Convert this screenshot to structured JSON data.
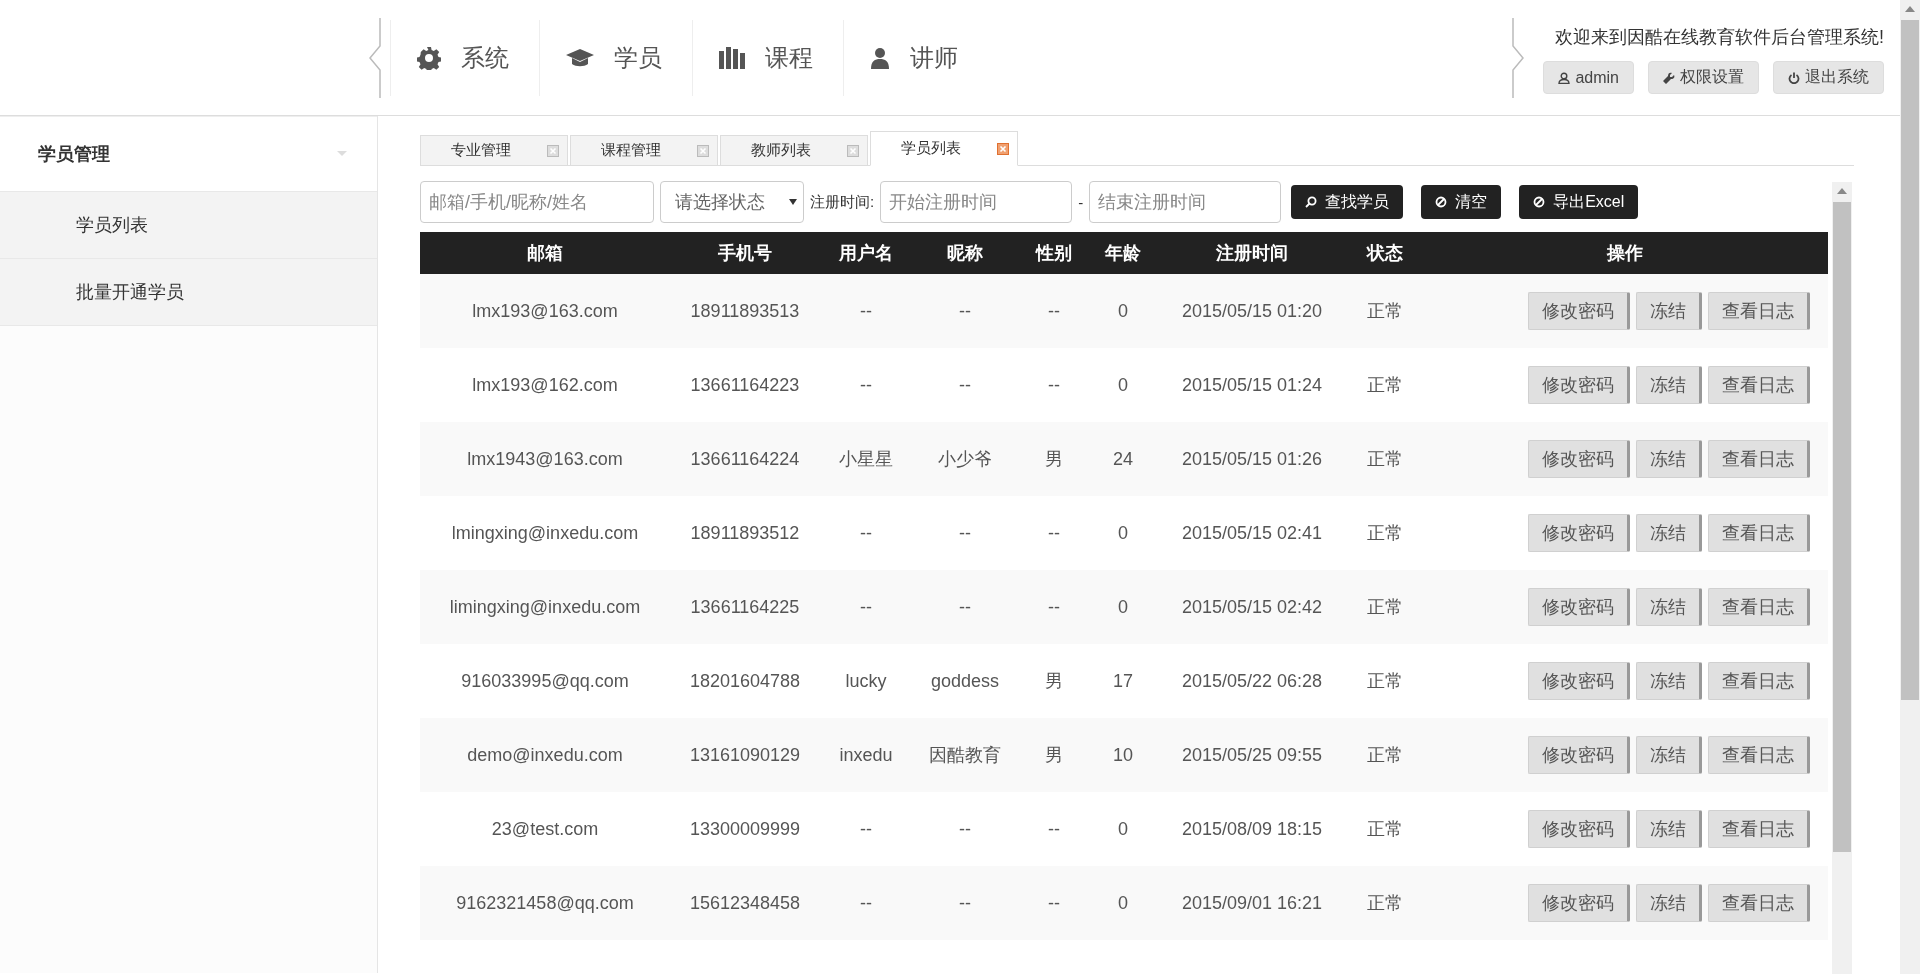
{
  "header": {
    "nav_items": [
      {
        "label": "系统"
      },
      {
        "label": "学员"
      },
      {
        "label": "课程"
      },
      {
        "label": "讲师"
      }
    ],
    "welcome": "欢迎来到因酷在线教育软件后台管理系统!",
    "user_buttons": [
      {
        "label": "admin"
      },
      {
        "label": "权限设置"
      },
      {
        "label": "退出系统"
      }
    ]
  },
  "sidebar": {
    "title": "学员管理",
    "items": [
      {
        "label": "学员列表"
      },
      {
        "label": "批量开通学员"
      }
    ]
  },
  "tabs": [
    {
      "label": "专业管理",
      "selected": false
    },
    {
      "label": "课程管理",
      "selected": false
    },
    {
      "label": "教师列表",
      "selected": false
    },
    {
      "label": "学员列表",
      "selected": true
    }
  ],
  "filters": {
    "search_placeholder": "邮箱/手机/昵称/姓名",
    "status_value": "请选择状态",
    "date_label": "注册时间:",
    "start_placeholder": "开始注册时间",
    "separator": "-",
    "end_placeholder": "结束注册时间",
    "buttons": [
      {
        "label": "查找学员"
      },
      {
        "label": "清空"
      },
      {
        "label": "导出Excel"
      }
    ]
  },
  "table": {
    "columns": [
      "邮箱",
      "手机号",
      "用户名",
      "昵称",
      "性别",
      "年龄",
      "注册时间",
      "状态",
      "操作"
    ],
    "rows": [
      {
        "cells": [
          "lmx193@163.com",
          "18911893513",
          "--",
          "--",
          "--",
          "0",
          "2015/05/15 01:20",
          "正常"
        ],
        "actions": [
          "修改密码",
          "冻结",
          "查看日志"
        ]
      },
      {
        "cells": [
          "lmx193@162.com",
          "13661164223",
          "--",
          "--",
          "--",
          "0",
          "2015/05/15 01:24",
          "正常"
        ],
        "actions": [
          "修改密码",
          "冻结",
          "查看日志"
        ]
      },
      {
        "cells": [
          "lmx1943@163.com",
          "13661164224",
          "小星星",
          "小少爷",
          "男",
          "24",
          "2015/05/15 01:26",
          "正常"
        ],
        "actions": [
          "修改密码",
          "冻结",
          "查看日志"
        ]
      },
      {
        "cells": [
          "lmingxing@inxedu.com",
          "18911893512",
          "--",
          "--",
          "--",
          "0",
          "2015/05/15 02:41",
          "正常"
        ],
        "actions": [
          "修改密码",
          "冻结",
          "查看日志"
        ]
      },
      {
        "cells": [
          "limingxing@inxedu.com",
          "13661164225",
          "--",
          "--",
          "--",
          "0",
          "2015/05/15 02:42",
          "正常"
        ],
        "actions": [
          "修改密码",
          "冻结",
          "查看日志"
        ]
      },
      {
        "cells": [
          "916033995@qq.com",
          "18201604788",
          "lucky",
          "goddess",
          "男",
          "17",
          "2015/05/22 06:28",
          "正常"
        ],
        "actions": [
          "修改密码",
          "冻结",
          "查看日志"
        ]
      },
      {
        "cells": [
          "demo@inxedu.com",
          "13161090129",
          "inxedu",
          "因酷教育",
          "男",
          "10",
          "2015/05/25 09:55",
          "正常"
        ],
        "actions": [
          "修改密码",
          "冻结",
          "查看日志"
        ]
      },
      {
        "cells": [
          "23@test.com",
          "13300009999",
          "--",
          "--",
          "--",
          "0",
          "2015/08/09 18:15",
          "正常"
        ],
        "actions": [
          "修改密码",
          "冻结",
          "查看日志"
        ]
      },
      {
        "cells": [
          "9162321458@qq.com",
          "15612348458",
          "--",
          "--",
          "--",
          "0",
          "2015/09/01 16:21",
          "正常"
        ],
        "actions": [
          "修改密码",
          "冻结",
          "查看日志"
        ]
      }
    ]
  }
}
